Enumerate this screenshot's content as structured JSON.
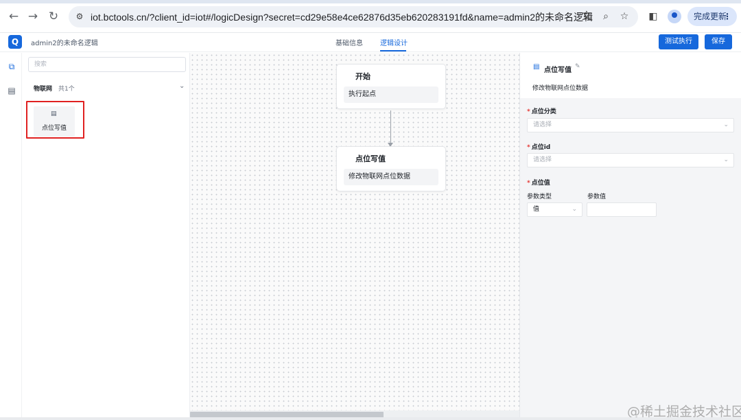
{
  "browser": {
    "url": "iot.bctools.cn/?client_id=iot#/logicDesign?secret=cd29e58e4ce62876d35eb620283191fd&name=admin2的未命名逻辑",
    "update_label": "完成更新"
  },
  "header": {
    "app_title": "admin2的未命名逻辑",
    "tabs": [
      {
        "label": "基础信息",
        "active": false
      },
      {
        "label": "逻辑设计",
        "active": true
      }
    ],
    "test_run_label": "测试执行",
    "save_label": "保存"
  },
  "components": {
    "search_placeholder": "搜索",
    "group": {
      "title": "物联网",
      "count": "共1个"
    },
    "items": [
      {
        "label": "点位写值",
        "highlighted": true
      }
    ]
  },
  "canvas": {
    "nodes": [
      {
        "title": "开始",
        "body": "执行起点"
      },
      {
        "title": "点位写值",
        "body": "修改物联网点位数据"
      }
    ]
  },
  "properties": {
    "title": "点位写值",
    "description": "修改物联网点位数据",
    "fields": {
      "point_category": {
        "label": "点位分类",
        "placeholder": "请选择",
        "required": true
      },
      "point_id": {
        "label": "点位id",
        "placeholder": "请选择",
        "required": true
      },
      "point_value": {
        "label": "点位值",
        "required": true,
        "param_type_label": "参数类型",
        "param_value_label": "参数值",
        "param_type_value": "值",
        "param_value": ""
      }
    }
  },
  "watermark": "@稀土掘金技术社区",
  "colors": {
    "accent": "#1668dc",
    "highlight": "#e02020"
  }
}
